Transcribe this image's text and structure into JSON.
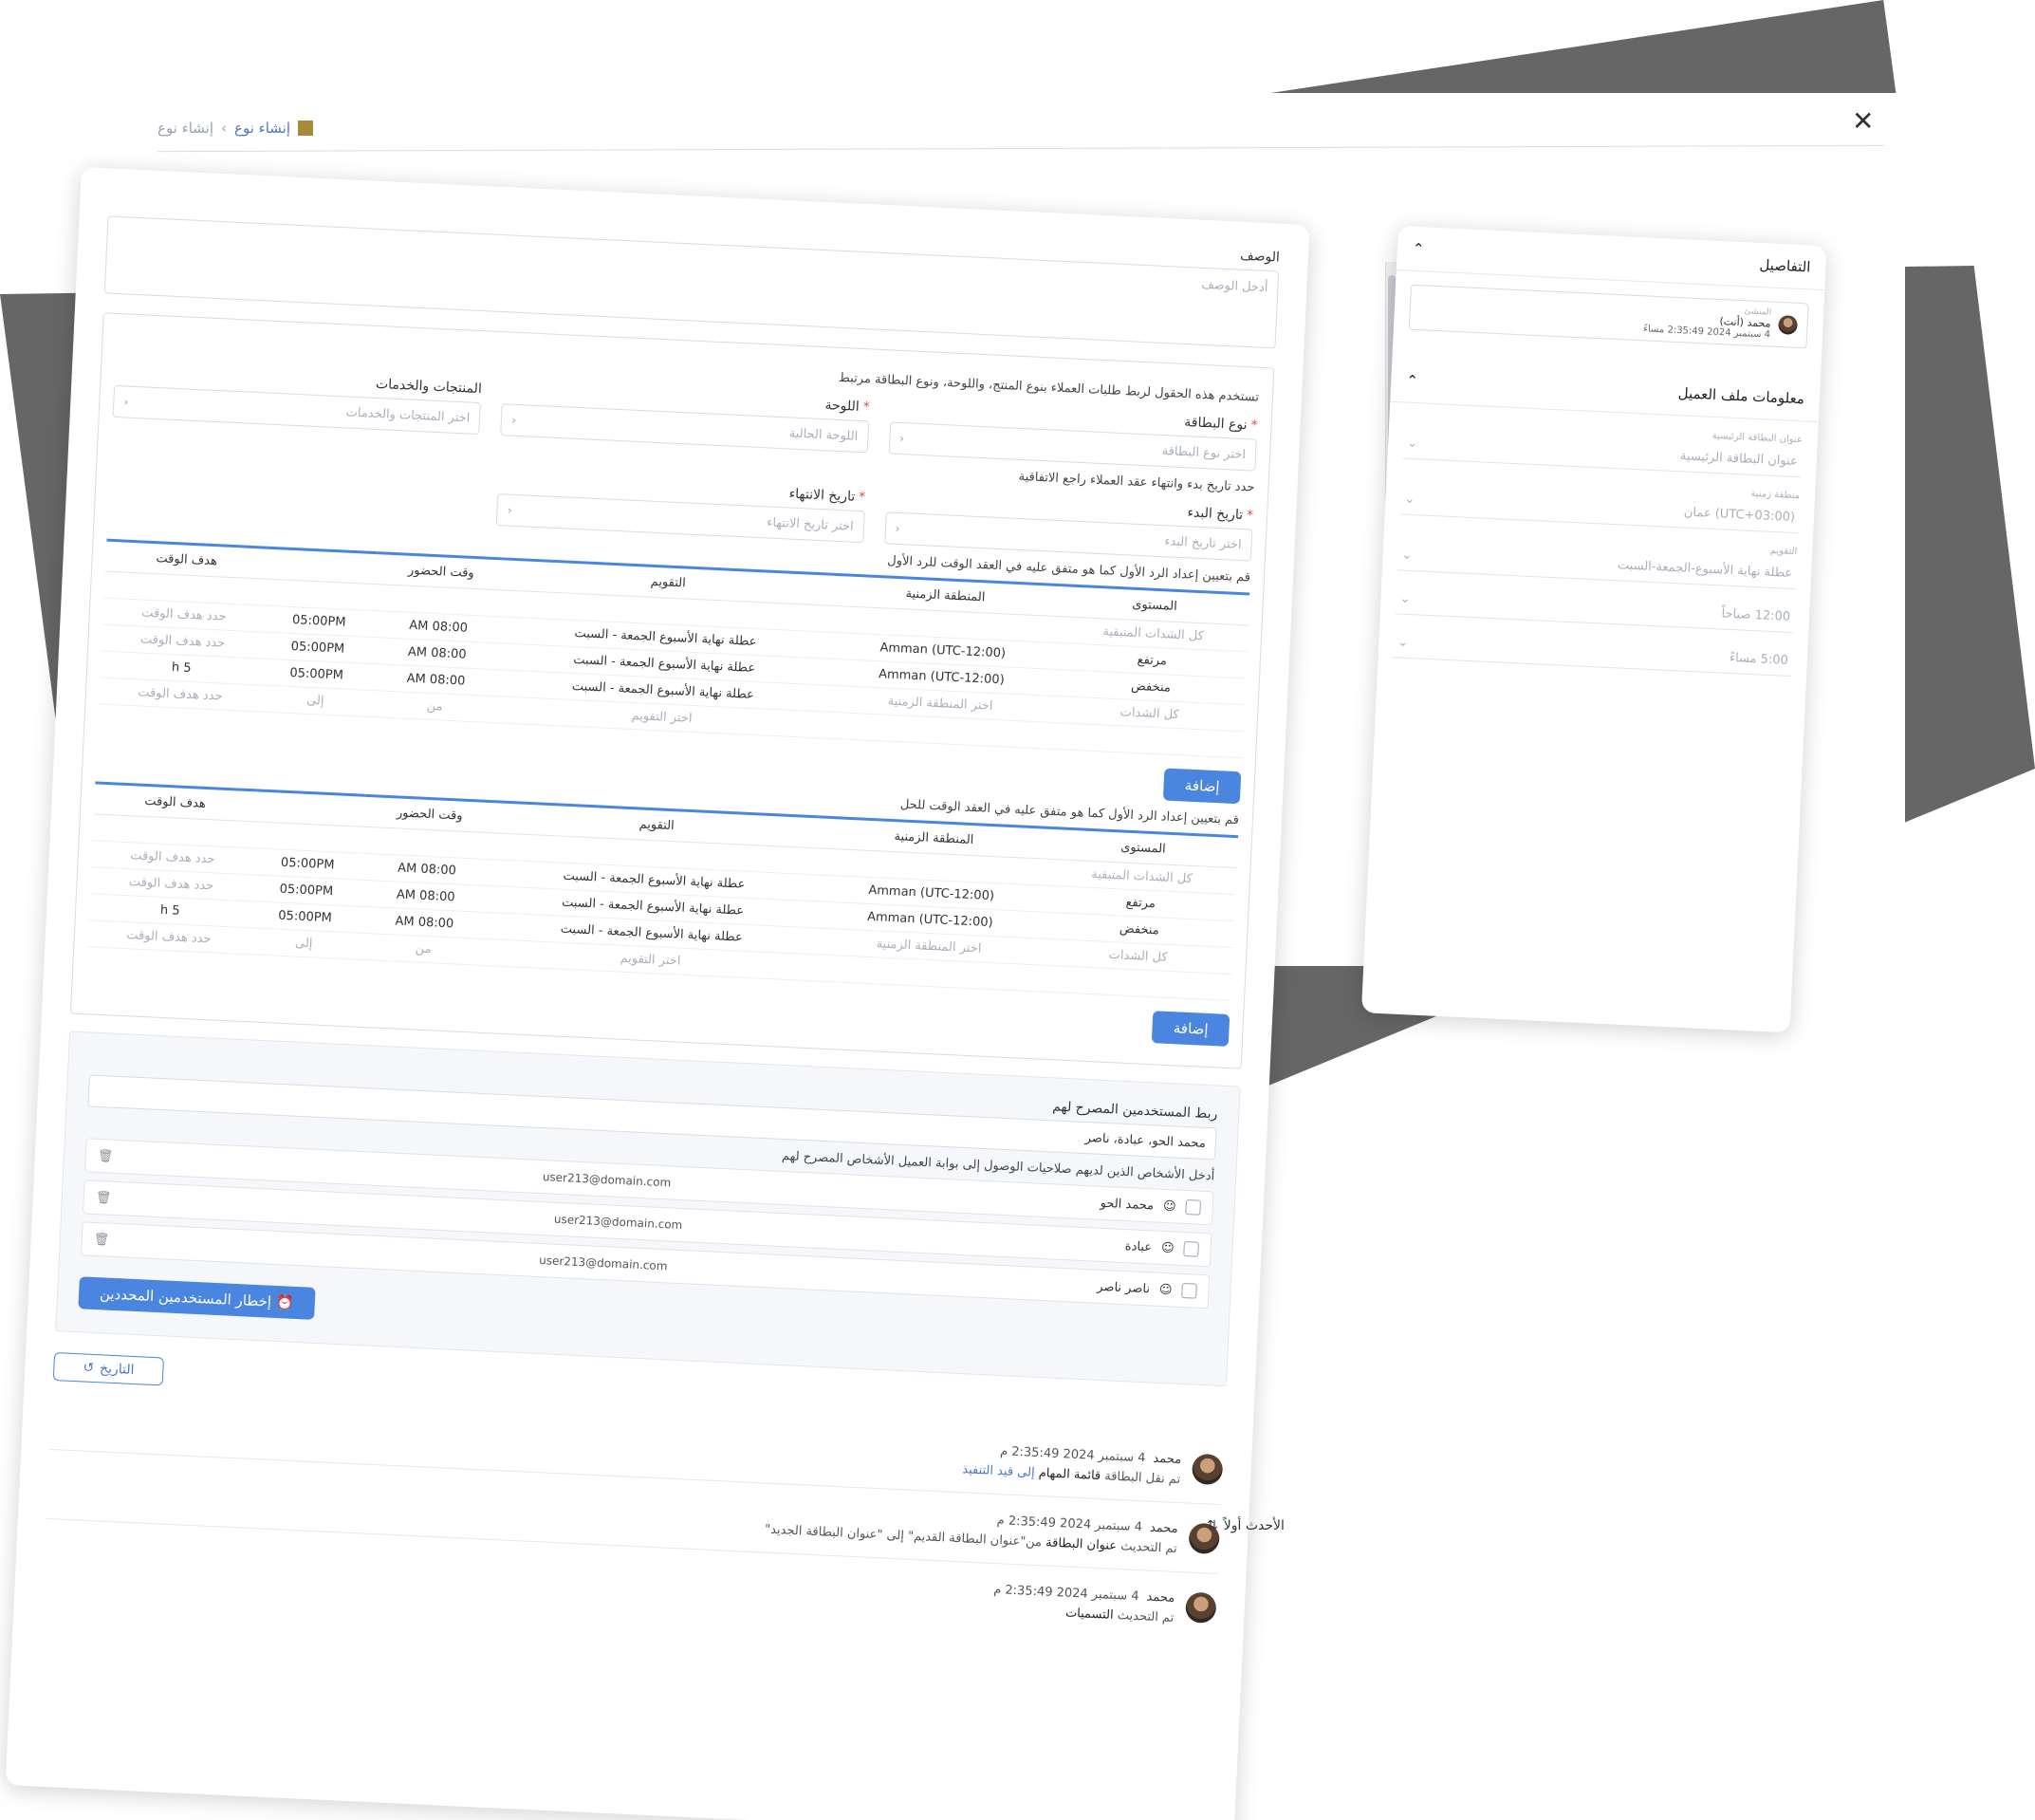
{
  "breadcrumb": {
    "current": "إنشاء نوع",
    "parent": "إنشاء نوع"
  },
  "description": {
    "label": "الوصف",
    "placeholder": "أدخل الوصف"
  },
  "link_section": {
    "hint": "تستخدم هذه الحقول لربط طلبات العملاء بنوع المنتج، واللوحة، ونوع البطاقة مرتبط",
    "products": {
      "label": "المنتجات والخدمات",
      "placeholder": "اختر المنتجات والخدمات"
    },
    "board": {
      "label": "اللوحة",
      "placeholder": "اللوحة الحالية"
    },
    "card_type": {
      "label": "نوع البطاقة",
      "placeholder": "اختر نوع البطاقة"
    },
    "dates_hint": "حدد تاريخ بدء وانتهاء عقد العملاء راجع الاتفاقية",
    "start": {
      "label": "تاريخ البدء",
      "placeholder": "اختر تاريخ البدء"
    },
    "end": {
      "label": "تاريخ الانتهاء",
      "placeholder": "اختر تاريخ الانتهاء"
    }
  },
  "first_response": {
    "hint": "قم بتعيين إعداد الرد الأول كما هو متفق عليه في العقد الوقت للرد الأول",
    "headers": [
      "المستوى",
      "المنطقة الزمنية",
      "التقويم",
      "وقت الحضور",
      "",
      "هدف الوقت"
    ],
    "rows": [
      [
        "كل الشدات المتبقية",
        "",
        "",
        "",
        "",
        ""
      ],
      [
        "مرتفع",
        "(UTC-12:00) Amman",
        "عطلة نهاية الأسبوع الجمعة - السبت",
        "08:00 AM",
        "05:00PM",
        "حدد هدف الوقت"
      ],
      [
        "منخفض",
        "(UTC-12:00) Amman",
        "عطلة نهاية الأسبوع الجمعة - السبت",
        "08:00 AM",
        "05:00PM",
        "حدد هدف الوقت"
      ],
      [
        "كل الشدات",
        "اختر المنطقة الزمنية",
        "عطلة نهاية الأسبوع الجمعة - السبت",
        "08:00 AM",
        "05:00PM",
        "5 h"
      ],
      [
        "",
        "",
        "اختر التقويم",
        "من",
        "إلى",
        "حدد هدف الوقت"
      ]
    ],
    "add_label": "إضافة"
  },
  "resolution": {
    "hint": "قم بتعيين إعداد الرد الأول كما هو متفق عليه في العقد الوقت للحل",
    "headers": [
      "المستوى",
      "المنطقة الزمنية",
      "التقويم",
      "وقت الحضور",
      "",
      "هدف الوقت"
    ],
    "rows": [
      [
        "كل الشدات المتبقية",
        "",
        "",
        "",
        "",
        ""
      ],
      [
        "مرتفع",
        "(UTC-12:00) Amman",
        "عطلة نهاية الأسبوع الجمعة - السبت",
        "08:00 AM",
        "05:00PM",
        "حدد هدف الوقت"
      ],
      [
        "منخفض",
        "(UTC-12:00) Amman",
        "عطلة نهاية الأسبوع الجمعة - السبت",
        "08:00 AM",
        "05:00PM",
        "حدد هدف الوقت"
      ],
      [
        "كل الشدات",
        "اختر المنطقة الزمنية",
        "عطلة نهاية الأسبوع الجمعة - السبت",
        "08:00 AM",
        "05:00PM",
        "5 h"
      ],
      [
        "",
        "",
        "اختر التقويم",
        "من",
        "إلى",
        "حدد هدف الوقت"
      ]
    ],
    "add_label": "إضافة"
  },
  "users": {
    "title": "ربط المستخدمين المصرح لهم",
    "selected": "محمد الحو، عبادة، ناصر",
    "hint": "أدخل الأشخاص الذين لديهم صلاحيات الوصول إلى بوابة العميل الأشخاص المصرح لهم",
    "list": [
      {
        "name": "محمد الحو",
        "email": "user213@domain.com"
      },
      {
        "name": "عبادة",
        "email": "user213@domain.com"
      },
      {
        "name": "ناصر ناصر",
        "email": "user213@domain.com"
      }
    ],
    "notify_label": "إخطار المستخدمين المحددين"
  },
  "history": {
    "button": "التاريخ",
    "sort": "الأحدث أولاً",
    "items": [
      {
        "user": "محمد",
        "time": "4 سبتمبر 2024 2:35:49 م",
        "desc_prefix": "تم نقل البطاقة",
        "bold": "قائمة المهام",
        "link": "إلى قيد التنفيذ"
      },
      {
        "user": "محمد",
        "time": "4 سبتمبر 2024 2:35:49 م",
        "desc_prefix": "تم التحديث",
        "bold": "عنوان البطاقة",
        "link": "من\"عنوان البطاقة القديم\" إلى \"عنوان البطاقة الجديد\""
      },
      {
        "user": "محمد",
        "time": "4 سبتمبر 2024 2:35:49 م",
        "desc_prefix": "تم التحديث",
        "bold": "التسميات",
        "link": ""
      }
    ]
  },
  "details": {
    "title": "التفاصيل",
    "creator_label": "المنشئ",
    "creator_name": "محمد (أنت)",
    "creator_time": "4 سبتمبر 2024 2:35:49 مساءً"
  },
  "customer_profile": {
    "title": "معلومات ملف العميل",
    "fields": [
      {
        "small": "عنوان البطاقة الرئيسية",
        "value": "عنوان البطاقة الرئيسية"
      },
      {
        "small": "منطقة زمنية",
        "value": "(UTC+03:00) عمان"
      },
      {
        "small": "التقويم",
        "value": "عطلة نهاية الأسبوع-الجمعة-السبت"
      },
      {
        "small": "",
        "value": "12:00 صباحاً"
      },
      {
        "small": "",
        "value": "5:00 مساءً"
      }
    ]
  }
}
